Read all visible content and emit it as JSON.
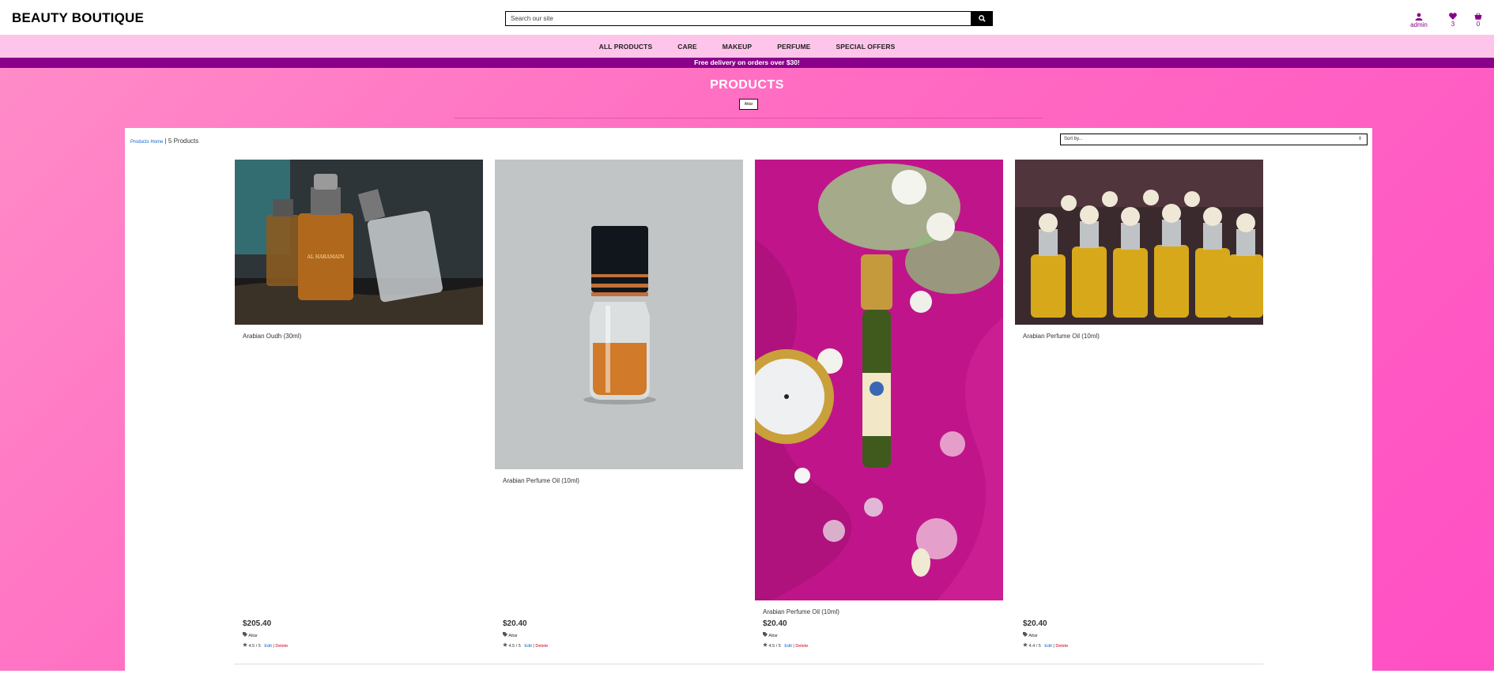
{
  "header": {
    "logo": "BEAUTY BOUTIQUE",
    "search_placeholder": "Search our site",
    "account_label": "admin",
    "wishlist_count": "3",
    "bag_count": "0"
  },
  "nav": {
    "items": [
      {
        "label": "ALL PRODUCTS"
      },
      {
        "label": "CARE"
      },
      {
        "label": "MAKEUP"
      },
      {
        "label": "PERFUME"
      },
      {
        "label": "SPECIAL OFFERS"
      }
    ]
  },
  "banner": "Free delivery on orders over $30!",
  "page": {
    "title": "PRODUCTS",
    "category_chip": "Attar",
    "breadcrumb_link": "Products Home",
    "breadcrumb_sep": " | ",
    "product_count": "5 Products",
    "sort_label": "Sort by...",
    "sort_arrows": "⇕"
  },
  "products": [
    {
      "name": "Arabian Oudh (30ml)",
      "price": "$205.40",
      "category": "Attar",
      "rating": "4.5 / 5",
      "edit": "Edit",
      "sep": " | ",
      "delete": "Delete"
    },
    {
      "name": "Arabian Perfume Oil (10ml)",
      "price": "$20.40",
      "category": "Attar",
      "rating": "4.5 / 5",
      "edit": "Edit",
      "sep": " | ",
      "delete": "Delete"
    },
    {
      "name": "Arabian Perfume Oil (10ml)",
      "price": "$20.40",
      "category": "Attar",
      "rating": "4.5 / 5",
      "edit": "Edit",
      "sep": " | ",
      "delete": "Delete"
    },
    {
      "name": "Arabian Perfume Oil (10ml)",
      "price": "$20.40",
      "category": "Attar",
      "rating": "4.4 / 5",
      "edit": "Edit",
      "sep": " | ",
      "delete": "Delete"
    }
  ],
  "colors": {
    "brand_purple": "#8b008b",
    "nav_pink": "#ffc4ea",
    "background_pink": "#ff6cc2",
    "link_blue": "#1166cc",
    "delete_red": "#d0021b"
  },
  "icons": [
    "search-icon",
    "user-icon",
    "heart-icon",
    "shopping-bag-icon",
    "tag-icon",
    "star-icon"
  ]
}
